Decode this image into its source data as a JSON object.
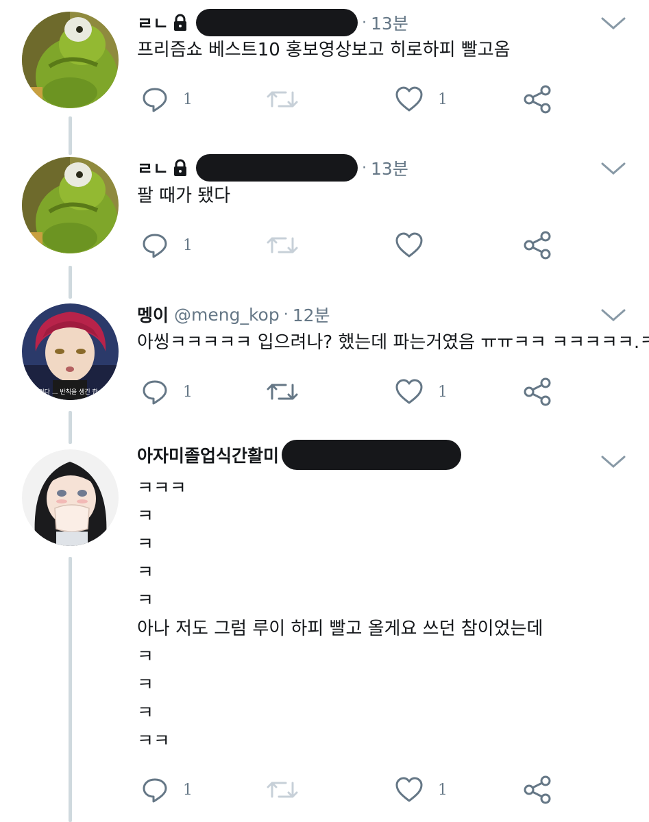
{
  "tweets": [
    {
      "name": "ㄹㄴ",
      "locked": true,
      "handle": "",
      "dot": "·",
      "time": "13분",
      "body": "프리즘쇼 베스트10 홍보영상보고 히로하피 빨고옴",
      "reply_count": "1",
      "retweet_count": "",
      "like_count": "1"
    },
    {
      "name": "ㄹㄴ",
      "locked": true,
      "handle": "",
      "dot": "·",
      "time": "13분",
      "body": "팔 때가 됐다",
      "reply_count": "1",
      "retweet_count": "",
      "like_count": ""
    },
    {
      "name": "멩이",
      "locked": false,
      "handle": "@meng_kop",
      "dot": "·",
      "time": "12분",
      "body": "아씽ㅋㅋㅋㅋㅋ 입으려나? 했는데 파는거였음 ㅠㅠㅋㅋ ㅋㅋㅋㅋㅋ.ㅋ",
      "avatar_caption": "전 물었다 ... 반칙을 생긴 한 거야?",
      "reply_count": "1",
      "retweet_count": "",
      "like_count": "1"
    },
    {
      "name": "아자미졸업식간활미",
      "locked": false,
      "handle": "",
      "dot": "",
      "time": "",
      "body_lines": [
        "ㅋㅋㅋ",
        "ㅋ",
        "ㅋ",
        "ㅋ",
        "ㅋ",
        "아나 저도 그럼 루이 하피 빨고 올게요 쓰던 참이었는데",
        "ㅋ",
        "ㅋ",
        "ㅋ",
        "ㅋㅋ"
      ],
      "reply_count": "1",
      "retweet_count": "",
      "like_count": "1"
    }
  ],
  "colors": {
    "text": "#14171a",
    "muted": "#657786",
    "icon": "#657786",
    "thread_line": "#cfd9de",
    "redaction": "#16171a"
  },
  "icons": [
    "reply-icon",
    "retweet-icon",
    "like-icon",
    "share-icon",
    "chevron-down-icon",
    "lock-icon"
  ]
}
